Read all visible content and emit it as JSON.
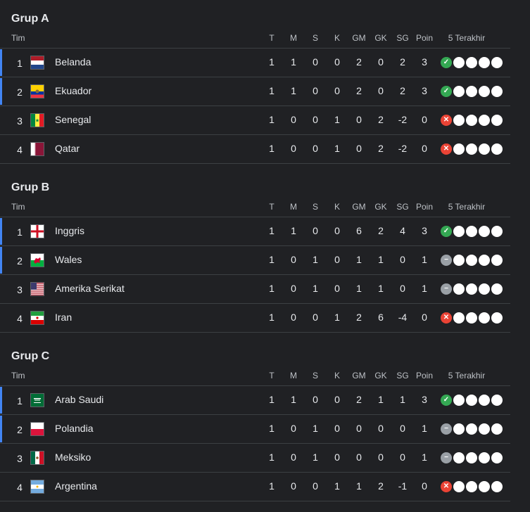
{
  "headers": {
    "team": "Tim",
    "T": "T",
    "M": "M",
    "S": "S",
    "K": "K",
    "GM": "GM",
    "GK": "GK",
    "SG": "SG",
    "P": "Poin",
    "last5": "5 Terakhir"
  },
  "colors": {
    "win": "#34a853",
    "loss": "#ea4335",
    "draw": "#9aa0a6",
    "advance": "#4285f4",
    "background": "#202124"
  },
  "groups": [
    {
      "title": "Grup A",
      "rows": [
        {
          "pos": "1",
          "name": "Belanda",
          "flag": "netherlands",
          "T": "1",
          "M": "1",
          "S": "0",
          "K": "0",
          "GM": "2",
          "GK": "0",
          "SG": "2",
          "P": "3",
          "form": [
            "W",
            "E",
            "E",
            "E",
            "E"
          ],
          "adv": true
        },
        {
          "pos": "2",
          "name": "Ekuador",
          "flag": "ecuador",
          "T": "1",
          "M": "1",
          "S": "0",
          "K": "0",
          "GM": "2",
          "GK": "0",
          "SG": "2",
          "P": "3",
          "form": [
            "W",
            "E",
            "E",
            "E",
            "E"
          ],
          "adv": true
        },
        {
          "pos": "3",
          "name": "Senegal",
          "flag": "senegal",
          "T": "1",
          "M": "0",
          "S": "0",
          "K": "1",
          "GM": "0",
          "GK": "2",
          "SG": "-2",
          "P": "0",
          "form": [
            "L",
            "E",
            "E",
            "E",
            "E"
          ],
          "adv": false
        },
        {
          "pos": "4",
          "name": "Qatar",
          "flag": "qatar",
          "T": "1",
          "M": "0",
          "S": "0",
          "K": "1",
          "GM": "0",
          "GK": "2",
          "SG": "-2",
          "P": "0",
          "form": [
            "L",
            "E",
            "E",
            "E",
            "E"
          ],
          "adv": false
        }
      ]
    },
    {
      "title": "Grup B",
      "rows": [
        {
          "pos": "1",
          "name": "Inggris",
          "flag": "england",
          "T": "1",
          "M": "1",
          "S": "0",
          "K": "0",
          "GM": "6",
          "GK": "2",
          "SG": "4",
          "P": "3",
          "form": [
            "W",
            "E",
            "E",
            "E",
            "E"
          ],
          "adv": true
        },
        {
          "pos": "2",
          "name": "Wales",
          "flag": "wales",
          "T": "1",
          "M": "0",
          "S": "1",
          "K": "0",
          "GM": "1",
          "GK": "1",
          "SG": "0",
          "P": "1",
          "form": [
            "D",
            "E",
            "E",
            "E",
            "E"
          ],
          "adv": true
        },
        {
          "pos": "3",
          "name": "Amerika Serikat",
          "flag": "usa",
          "T": "1",
          "M": "0",
          "S": "1",
          "K": "0",
          "GM": "1",
          "GK": "1",
          "SG": "0",
          "P": "1",
          "form": [
            "D",
            "E",
            "E",
            "E",
            "E"
          ],
          "adv": false
        },
        {
          "pos": "4",
          "name": "Iran",
          "flag": "iran",
          "T": "1",
          "M": "0",
          "S": "0",
          "K": "1",
          "GM": "2",
          "GK": "6",
          "SG": "-4",
          "P": "0",
          "form": [
            "L",
            "E",
            "E",
            "E",
            "E"
          ],
          "adv": false
        }
      ]
    },
    {
      "title": "Grup C",
      "rows": [
        {
          "pos": "1",
          "name": "Arab Saudi",
          "flag": "saudi",
          "T": "1",
          "M": "1",
          "S": "0",
          "K": "0",
          "GM": "2",
          "GK": "1",
          "SG": "1",
          "P": "3",
          "form": [
            "W",
            "E",
            "E",
            "E",
            "E"
          ],
          "adv": true
        },
        {
          "pos": "2",
          "name": "Polandia",
          "flag": "poland",
          "T": "1",
          "M": "0",
          "S": "1",
          "K": "0",
          "GM": "0",
          "GK": "0",
          "SG": "0",
          "P": "1",
          "form": [
            "D",
            "E",
            "E",
            "E",
            "E"
          ],
          "adv": true
        },
        {
          "pos": "3",
          "name": "Meksiko",
          "flag": "mexico",
          "T": "1",
          "M": "0",
          "S": "1",
          "K": "0",
          "GM": "0",
          "GK": "0",
          "SG": "0",
          "P": "1",
          "form": [
            "D",
            "E",
            "E",
            "E",
            "E"
          ],
          "adv": false
        },
        {
          "pos": "4",
          "name": "Argentina",
          "flag": "argentina",
          "T": "1",
          "M": "0",
          "S": "0",
          "K": "1",
          "GM": "1",
          "GK": "2",
          "SG": "-1",
          "P": "0",
          "form": [
            "L",
            "E",
            "E",
            "E",
            "E"
          ],
          "adv": false
        }
      ]
    }
  ]
}
